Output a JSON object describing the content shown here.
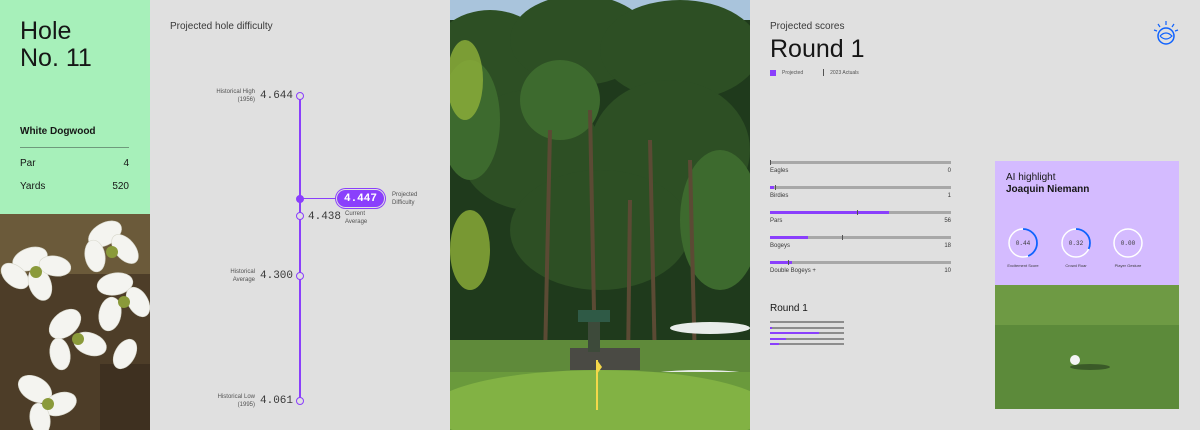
{
  "hole": {
    "title_line1": "Hole",
    "title_line2": "No. 11",
    "name": "White Dogwood",
    "stats": [
      {
        "label": "Par",
        "value": "4"
      },
      {
        "label": "Yards",
        "value": "520"
      }
    ]
  },
  "difficulty": {
    "title": "Projected hole difficulty",
    "points": [
      {
        "label_line1": "Historical High",
        "label_line2": "(1956)",
        "value": "4.644"
      },
      {
        "label_line1": "Current",
        "label_line2": "Average",
        "value": "4.438"
      },
      {
        "label_line1": "Historical",
        "label_line2": "Average",
        "value": "4.300"
      },
      {
        "label_line1": "Historical Low",
        "label_line2": "(1995)",
        "value": "4.061"
      }
    ],
    "projected": {
      "value": "4.447",
      "label_line1": "Projected",
      "label_line2": "Difficulty"
    }
  },
  "scores": {
    "subtitle": "Projected scores",
    "title": "Round 1",
    "legend": {
      "projected": "Projected",
      "actual": "2023 Actuals"
    },
    "bars": [
      {
        "label": "Eagles",
        "count": "0",
        "projected_pct": 0,
        "actual_pct": 0
      },
      {
        "label": "Birdies",
        "count": "1",
        "projected_pct": 2,
        "actual_pct": 3
      },
      {
        "label": "Pars",
        "count": "56",
        "projected_pct": 66,
        "actual_pct": 48
      },
      {
        "label": "Bogeys",
        "count": "18",
        "projected_pct": 21,
        "actual_pct": 40
      },
      {
        "label": "Double Bogeys +",
        "count": "10",
        "projected_pct": 12,
        "actual_pct": 10
      }
    ],
    "round_section": {
      "title": "Round 1",
      "mini_bars": [
        0,
        3,
        66,
        21,
        12
      ]
    }
  },
  "ai": {
    "label": "AI highlight",
    "player": "Joaquin Niemann",
    "gauges": [
      {
        "value": "0.44",
        "caption": "Excitement Score",
        "fraction": 0.44
      },
      {
        "value": "0.32",
        "caption": "Crowd Roar",
        "fraction": 0.32
      },
      {
        "value": "0.00",
        "caption": "Player Gesture",
        "fraction": 0.0
      }
    ]
  },
  "colors": {
    "accent": "#8a3ffc",
    "hole_panel": "#a7f0ba",
    "ai_card": "#d4bbff",
    "background": "#e0e0e0"
  },
  "icons": {
    "logo": "ibm-watson-logo-icon"
  }
}
